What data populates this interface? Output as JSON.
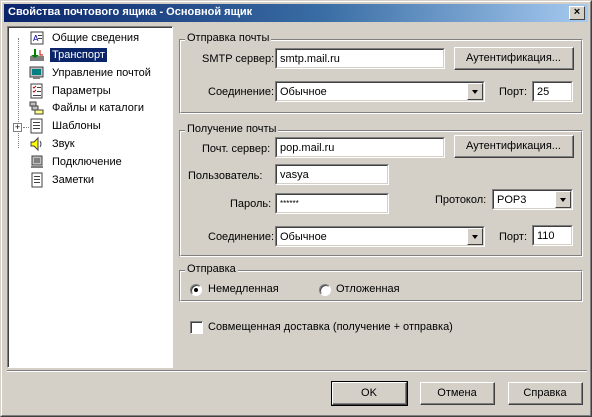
{
  "window": {
    "title": "Свойства почтового ящика - Основной ящик",
    "close_glyph": "×"
  },
  "tree": {
    "items": [
      {
        "label": "Общие сведения",
        "icon": "info-icon"
      },
      {
        "label": "Транспорт",
        "icon": "transport-icon",
        "selected": true
      },
      {
        "label": "Управление почтой",
        "icon": "mail-management-icon"
      },
      {
        "label": "Параметры",
        "icon": "parameters-icon"
      },
      {
        "label": "Файлы и каталоги",
        "icon": "folder-icon"
      },
      {
        "label": "Шаблоны",
        "icon": "templates-icon",
        "expander": "+"
      },
      {
        "label": "Звук",
        "icon": "sound-icon"
      },
      {
        "label": "Подключение",
        "icon": "connection-icon"
      },
      {
        "label": "Заметки",
        "icon": "notes-icon"
      }
    ]
  },
  "send": {
    "group_title": "Отправка почты",
    "server_label": "SMTP сервер:",
    "server_value": "smtp.mail.ru",
    "auth_button": "Аутентификация...",
    "connection_label": "Соединение:",
    "connection_value": "Обычное",
    "port_label": "Порт:",
    "port_value": "25"
  },
  "receive": {
    "group_title": "Получение почты",
    "server_label": "Почт. сервер:",
    "server_value": "pop.mail.ru",
    "auth_button": "Аутентификация...",
    "user_label": "Пользователь:",
    "user_value": "vasya",
    "password_label": "Пароль:",
    "password_value": "******",
    "protocol_label": "Протокол:",
    "protocol_value": "POP3",
    "connection_label": "Соединение:",
    "connection_value": "Обычное",
    "port_label": "Порт:",
    "port_value": "110"
  },
  "sending": {
    "group_title": "Отправка",
    "option_immediate": "Немедленная",
    "option_deferred": "Отложенная",
    "selected": "immediate"
  },
  "combined": {
    "label": "Совмещенная доставка (получение + отправка)",
    "checked": false
  },
  "buttons": {
    "ok": "OK",
    "cancel": "Отмена",
    "help": "Справка"
  }
}
